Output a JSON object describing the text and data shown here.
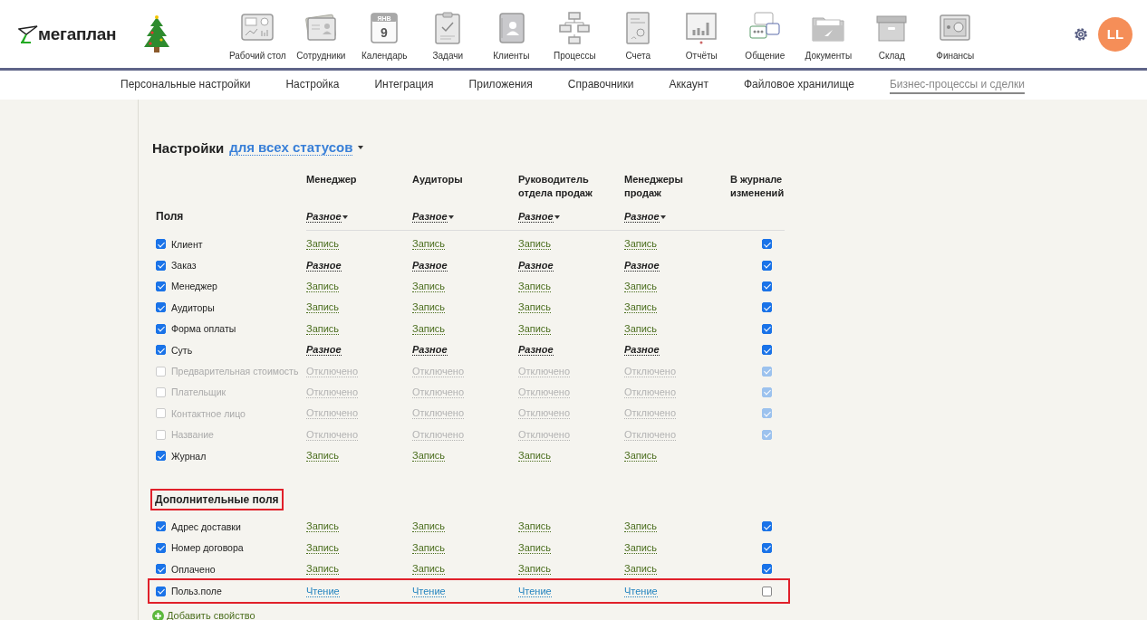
{
  "header": {
    "logo": "мегаплан",
    "nav": [
      {
        "label": "Рабочий стол"
      },
      {
        "label": "Сотрудники"
      },
      {
        "label": "Календарь",
        "calendar": {
          "month": "ЯНВ",
          "day": "9"
        }
      },
      {
        "label": "Задачи"
      },
      {
        "label": "Клиенты"
      },
      {
        "label": "Процессы"
      },
      {
        "label": "Счета"
      },
      {
        "label": "Отчёты"
      },
      {
        "label": "Общение"
      },
      {
        "label": "Документы"
      },
      {
        "label": "Склад"
      },
      {
        "label": "Финансы"
      }
    ],
    "avatar": "LL"
  },
  "subnav": [
    {
      "label": "Персональные настройки",
      "selected": false
    },
    {
      "label": "Настройка",
      "selected": false
    },
    {
      "label": "Интеграция",
      "selected": false
    },
    {
      "label": "Приложения",
      "selected": false
    },
    {
      "label": "Справочники",
      "selected": false
    },
    {
      "label": "Аккаунт",
      "selected": false
    },
    {
      "label": "Файловое хранилище",
      "selected": false
    },
    {
      "label": "Бизнес-процессы и сделки",
      "selected": true
    }
  ],
  "settings": {
    "title": "Настройки",
    "scope": "для всех статусов",
    "fields_label": "Поля",
    "columns": [
      {
        "title": "Менеджер",
        "preset": "Разное"
      },
      {
        "title": "Аудиторы",
        "preset": "Разное"
      },
      {
        "title": "Руководитель\nотдела продаж",
        "preset": "Разное"
      },
      {
        "title": "Менеджеры\nпродаж",
        "preset": "Разное"
      }
    ],
    "journal_column": "В журнале\nизменений",
    "rows": [
      {
        "name": "Клиент",
        "checked": true,
        "disabled": false,
        "journal": true,
        "cells": [
          {
            "text": "Запись",
            "kind": "write"
          },
          {
            "text": "Запись",
            "kind": "write"
          },
          {
            "text": "Запись",
            "kind": "write"
          },
          {
            "text": "Запись",
            "kind": "write"
          }
        ]
      },
      {
        "name": "Заказ",
        "checked": true,
        "disabled": false,
        "journal": true,
        "cells": [
          {
            "text": "Разное",
            "kind": "mixed"
          },
          {
            "text": "Разное",
            "kind": "mixed"
          },
          {
            "text": "Разное",
            "kind": "mixed"
          },
          {
            "text": "Разное",
            "kind": "mixed"
          }
        ]
      },
      {
        "name": "Менеджер",
        "checked": true,
        "disabled": false,
        "journal": true,
        "cells": [
          {
            "text": "Запись",
            "kind": "write"
          },
          {
            "text": "Запись",
            "kind": "write"
          },
          {
            "text": "Запись",
            "kind": "write"
          },
          {
            "text": "Запись",
            "kind": "write"
          }
        ]
      },
      {
        "name": "Аудиторы",
        "checked": true,
        "disabled": false,
        "journal": true,
        "cells": [
          {
            "text": "Запись",
            "kind": "write"
          },
          {
            "text": "Запись",
            "kind": "write"
          },
          {
            "text": "Запись",
            "kind": "write"
          },
          {
            "text": "Запись",
            "kind": "write"
          }
        ]
      },
      {
        "name": "Форма оплаты",
        "checked": true,
        "disabled": false,
        "journal": true,
        "cells": [
          {
            "text": "Запись",
            "kind": "write"
          },
          {
            "text": "Запись",
            "kind": "write"
          },
          {
            "text": "Запись",
            "kind": "write"
          },
          {
            "text": "Запись",
            "kind": "write"
          }
        ]
      },
      {
        "name": "Суть",
        "checked": true,
        "disabled": false,
        "journal": true,
        "cells": [
          {
            "text": "Разное",
            "kind": "mixed"
          },
          {
            "text": "Разное",
            "kind": "mixed"
          },
          {
            "text": "Разное",
            "kind": "mixed"
          },
          {
            "text": "Разное",
            "kind": "mixed"
          }
        ]
      },
      {
        "name": "Предварительная стоимость",
        "checked": false,
        "disabled": true,
        "journal": true,
        "cells": [
          {
            "text": "Отключено",
            "kind": "off"
          },
          {
            "text": "Отключено",
            "kind": "off"
          },
          {
            "text": "Отключено",
            "kind": "off"
          },
          {
            "text": "Отключено",
            "kind": "off"
          }
        ]
      },
      {
        "name": "Плательщик",
        "checked": false,
        "disabled": true,
        "journal": true,
        "cells": [
          {
            "text": "Отключено",
            "kind": "off"
          },
          {
            "text": "Отключено",
            "kind": "off"
          },
          {
            "text": "Отключено",
            "kind": "off"
          },
          {
            "text": "Отключено",
            "kind": "off"
          }
        ]
      },
      {
        "name": "Контактное лицо",
        "checked": false,
        "disabled": true,
        "journal": true,
        "cells": [
          {
            "text": "Отключено",
            "kind": "off"
          },
          {
            "text": "Отключено",
            "kind": "off"
          },
          {
            "text": "Отключено",
            "kind": "off"
          },
          {
            "text": "Отключено",
            "kind": "off"
          }
        ]
      },
      {
        "name": "Название",
        "checked": false,
        "disabled": true,
        "journal": true,
        "cells": [
          {
            "text": "Отключено",
            "kind": "off"
          },
          {
            "text": "Отключено",
            "kind": "off"
          },
          {
            "text": "Отключено",
            "kind": "off"
          },
          {
            "text": "Отключено",
            "kind": "off"
          }
        ]
      },
      {
        "name": "Журнал",
        "checked": true,
        "disabled": false,
        "cells": [
          {
            "text": "Запись",
            "kind": "write"
          },
          {
            "text": "Запись",
            "kind": "write"
          },
          {
            "text": "Запись",
            "kind": "write"
          },
          {
            "text": "Запись",
            "kind": "write"
          }
        ]
      }
    ],
    "extra": {
      "title": "Дополнительные поля",
      "highlighted": true,
      "rows": [
        {
          "name": "Адрес доставки",
          "checked": true,
          "disabled": false,
          "journal": true,
          "highlighted": false,
          "cells": [
            {
              "text": "Запись",
              "kind": "write"
            },
            {
              "text": "Запись",
              "kind": "write"
            },
            {
              "text": "Запись",
              "kind": "write"
            },
            {
              "text": "Запись",
              "kind": "write"
            }
          ]
        },
        {
          "name": "Номер договора",
          "checked": true,
          "disabled": false,
          "journal": true,
          "highlighted": false,
          "cells": [
            {
              "text": "Запись",
              "kind": "write"
            },
            {
              "text": "Запись",
              "kind": "write"
            },
            {
              "text": "Запись",
              "kind": "write"
            },
            {
              "text": "Запись",
              "kind": "write"
            }
          ]
        },
        {
          "name": "Оплачено",
          "checked": true,
          "disabled": false,
          "journal": true,
          "highlighted": false,
          "cells": [
            {
              "text": "Запись",
              "kind": "write"
            },
            {
              "text": "Запись",
              "kind": "write"
            },
            {
              "text": "Запись",
              "kind": "write"
            },
            {
              "text": "Запись",
              "kind": "write"
            }
          ]
        },
        {
          "name": "Польз.поле",
          "checked": true,
          "disabled": false,
          "journal": false,
          "highlighted": true,
          "cells": [
            {
              "text": "Чтение",
              "kind": "read"
            },
            {
              "text": "Чтение",
              "kind": "read"
            },
            {
              "text": "Чтение",
              "kind": "read"
            },
            {
              "text": "Чтение",
              "kind": "read"
            }
          ]
        }
      ]
    },
    "add": "Добавить свойство"
  }
}
